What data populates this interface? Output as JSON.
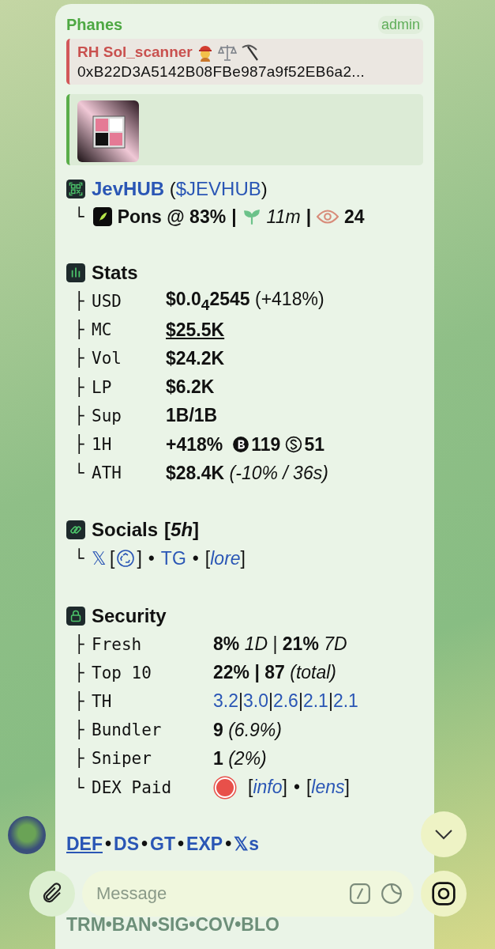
{
  "sender": {
    "name": "Phanes",
    "badge": "admin"
  },
  "reply": {
    "title": "RH Sol_scanner",
    "address": "0xB22D3A5142B08FBe987a9f52EB6a2..."
  },
  "token": {
    "name": "JevHUB",
    "open": "(",
    "close": ")",
    "ticker": "$JEVHUB",
    "platform": "Pons @ 83%",
    "age": "11m",
    "watchers": "24",
    "branch": "└",
    "sep": "|"
  },
  "stats": {
    "title": "Stats",
    "rows": [
      {
        "branch": "├",
        "label": "USD",
        "kind": "text",
        "value": "**$0.0$_{4}$2545** (+418%)"
      },
      {
        "branch": "├",
        "label": "MC",
        "kind": "link",
        "value": "$25.5K"
      },
      {
        "branch": "├",
        "label": "Vol",
        "kind": "text",
        "value": "**$24.2K**"
      },
      {
        "branch": "├",
        "label": "LP",
        "kind": "text",
        "value": "**$6.2K**"
      },
      {
        "branch": "├",
        "label": "Sup",
        "kind": "text",
        "value": "**1B/1B**"
      },
      {
        "branch": "├",
        "label": "1H",
        "kind": "flow",
        "value": "**+418%**",
        "buys": "119",
        "sells": "51"
      },
      {
        "branch": "└",
        "label": "ATH",
        "kind": "text",
        "value": "**$28.4K** *(-10% / 36s)*"
      }
    ]
  },
  "socials": {
    "title": "Socials",
    "age": "[*5h*]",
    "branch": "└",
    "x": "𝕏",
    "open": "[",
    "close": "]",
    "bullet": "•",
    "tg": "TG",
    "lore": "lore"
  },
  "security": {
    "title": "Security",
    "rows": [
      {
        "branch": "├",
        "label": "Fresh",
        "kind": "text",
        "value": "**8%** *1D* | **21%** *7D*"
      },
      {
        "branch": "├",
        "label": "Top 10",
        "kind": "text",
        "value": "**22% | 87** *(total)*"
      },
      {
        "branch": "├",
        "label": "TH",
        "kind": "holders",
        "sep": "|",
        "values": [
          "3.2",
          "3.0",
          "2.6",
          "2.1",
          "2.1"
        ]
      },
      {
        "branch": "├",
        "label": "Bundler",
        "kind": "text",
        "value": "**9** *(6.9%)*"
      },
      {
        "branch": "├",
        "label": "Sniper",
        "kind": "text",
        "value": "**1** *(2%)*"
      },
      {
        "branch": "└",
        "label": "DEX Paid",
        "kind": "status",
        "paid": false,
        "color": "#e8504a",
        "open": "[",
        "close": "]",
        "bullet": "•",
        "info": "info",
        "lens": "lens"
      }
    ]
  },
  "links_sep": "•",
  "links": [
    {
      "label": "DEF",
      "selected": true
    },
    {
      "label": "DS",
      "selected": false
    },
    {
      "label": "GT",
      "selected": false
    },
    {
      "label": "EXP",
      "selected": false
    },
    {
      "label": "𝕏s",
      "selected": false
    }
  ],
  "more_links": "TRM•BAN•SIG•COV•BLO",
  "composer": {
    "placeholder": "Message"
  }
}
